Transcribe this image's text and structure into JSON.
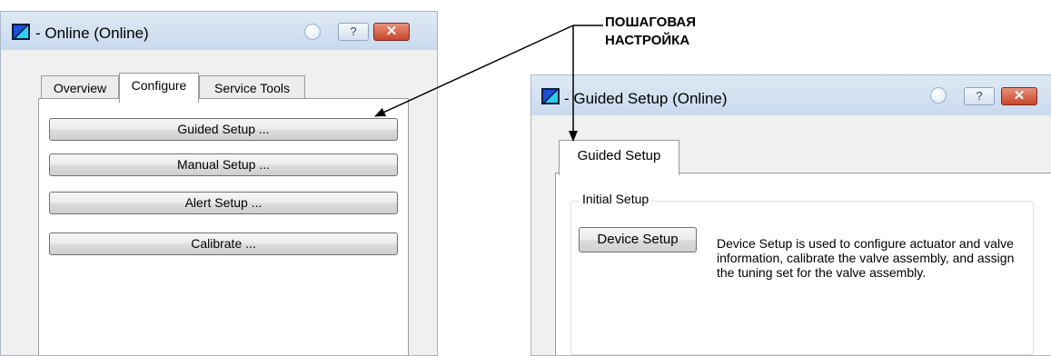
{
  "callout": {
    "line1": "ПОШАГОВАЯ",
    "line2": "НАСТРОЙКА"
  },
  "left_window": {
    "title": "- Online (Online)",
    "help_label": "?",
    "close_label": "✕",
    "tabs": [
      {
        "label": "Overview",
        "active": false
      },
      {
        "label": "Configure",
        "active": true
      },
      {
        "label": "Service Tools",
        "active": false
      }
    ],
    "buttons": [
      {
        "label": "Guided Setup ..."
      },
      {
        "label": "Manual Setup ..."
      },
      {
        "label": "Alert Setup ..."
      },
      {
        "label": "Calibrate ..."
      }
    ]
  },
  "right_window": {
    "title": "- Guided Setup (Online)",
    "help_label": "?",
    "close_label": "✕",
    "tab": {
      "label": "Guided Setup"
    },
    "group_label": "Initial Setup",
    "device_setup_button": "Device Setup",
    "description": "Device Setup is used to configure actuator and valve information, calibrate the valve assembly, and assign the tuning set for the valve assembly."
  },
  "colors": {
    "titlebar": "#c9daee",
    "window_bg": "#f0f0f0",
    "close_button": "#c8462b",
    "arrow": "#000000"
  }
}
